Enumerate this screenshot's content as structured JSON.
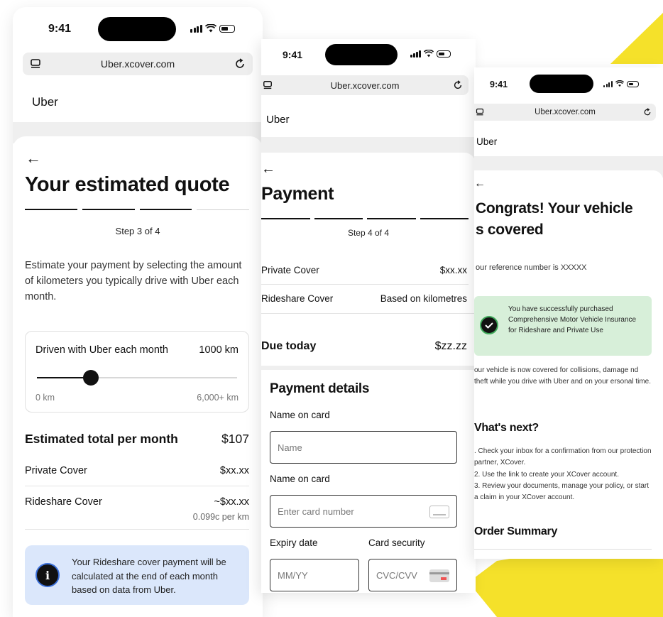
{
  "colors": {
    "yellow": "#f5e12a",
    "info_bg": "#dbe7fb",
    "success_bg": "#d7efd9",
    "success_border": "#3fa85a"
  },
  "icons": {
    "back": "arrow-left-icon",
    "tabs": "tabs-icon",
    "reload": "reload-icon",
    "info": "info-icon",
    "check": "check-icon",
    "card": "card-icon"
  },
  "screen1": {
    "time": "9:41",
    "url": "Uber.xcover.com",
    "brand": "Uber",
    "back_glyph": "←",
    "title": "Your estimated quote",
    "step_text": "Step 3 of 4",
    "step_progress": 0.75,
    "description": "Estimate your payment by selecting the amount of kilometers you typically drive with Uber each month.",
    "slider": {
      "label": "Driven with Uber each month",
      "value_text": "1000 km",
      "min_label": "0 km",
      "max_label": "6,000+ km",
      "fraction": 0.27
    },
    "total_label": "Estimated total per month",
    "total_value": "$107",
    "private_label": "Private Cover",
    "private_value": "$xx.xx",
    "rideshare_label": "Rideshare Cover",
    "rideshare_value": "~$xx.xx",
    "rideshare_sub": "0.099c per km",
    "info_glyph": "i",
    "info_text": "Your Rideshare cover payment will be calculated at the end of each month based on data from Uber."
  },
  "screen2": {
    "time": "9:41",
    "url": "Uber.xcover.com",
    "brand": "Uber",
    "back_glyph": "←",
    "title": "Payment",
    "step_text": "Step 4 of 4",
    "step_progress": 1.0,
    "private_label": "Private Cover",
    "private_value": "$xx.xx",
    "rideshare_label": "Rideshare Cover",
    "rideshare_value": "Based on kilometres",
    "due_label": "Due today",
    "due_value": "$zz.zz",
    "details_title": "Payment details",
    "name_label": "Name on card",
    "name_placeholder": "Name",
    "card_label": "Name on card",
    "card_placeholder": "Enter card number",
    "expiry_label": "Expiry date",
    "expiry_placeholder": "MM/YY",
    "security_label": "Card security",
    "security_placeholder": "CVC/CVV"
  },
  "screen3": {
    "time": "9:41",
    "url": "Uber.xcover.com",
    "brand": "Uber",
    "back_glyph": "←",
    "title_line1": "Congrats! Your vehicle",
    "title_line2": "s covered",
    "reference": "our reference number is XXXXX",
    "success_text": "You have successfully purchased Comprehensive Motor Vehicle Insurance for Rideshare and Private Use",
    "covered_text": "our vehicle is now covered for collisions, damage nd theft while you drive with Uber and on your ersonal time.",
    "next_title": "Vhat's next?",
    "next_items": [
      ". Check your inbox for a confirmation from our protection partner, XCover.",
      "2. Use the link to create your XCover account.",
      "3. Review your documents, manage your policy, or start a claim in your XCover account."
    ],
    "order_title": "Order Summary"
  }
}
